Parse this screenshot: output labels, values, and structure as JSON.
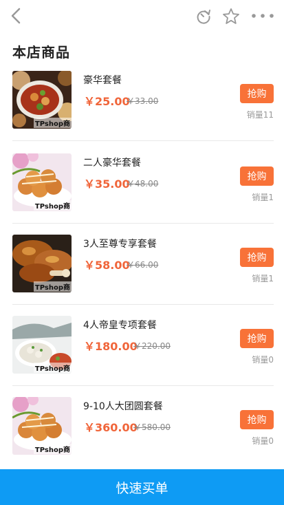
{
  "header": {
    "icons": [
      "back-arrow-icon",
      "refresh-icon",
      "star-icon",
      "more-dots-icon"
    ],
    "icon_color": "#999999"
  },
  "section_title": "本店商品",
  "products": [
    {
      "name": "豪华套餐",
      "price": "￥25.00",
      "original_price": "￥33.00",
      "buy_label": "抢购",
      "sales": "销量11",
      "watermark": "TPshop商"
    },
    {
      "name": "二人豪华套餐",
      "price": "￥35.00",
      "original_price": "￥48.00",
      "buy_label": "抢购",
      "sales": "销量1",
      "watermark": "TPshop商"
    },
    {
      "name": "3人至尊专享套餐",
      "price": "￥58.00",
      "original_price": "￥66.00",
      "buy_label": "抢购",
      "sales": "销量1",
      "watermark": "TPshop商"
    },
    {
      "name": "4人帝皇专项套餐",
      "price": "￥180.00",
      "original_price": "￥220.00",
      "buy_label": "抢购",
      "sales": "销量0",
      "watermark": "TPshop商"
    },
    {
      "name": "9-10人大团圆套餐",
      "price": "￥360.00",
      "original_price": "￥580.00",
      "buy_label": "抢购",
      "sales": "销量0",
      "watermark": "TPshop商"
    }
  ],
  "footer": {
    "button_label": "快速买单"
  },
  "colors": {
    "accent": "#f87238",
    "price": "#f0653a",
    "footer": "#0e9bf4"
  }
}
